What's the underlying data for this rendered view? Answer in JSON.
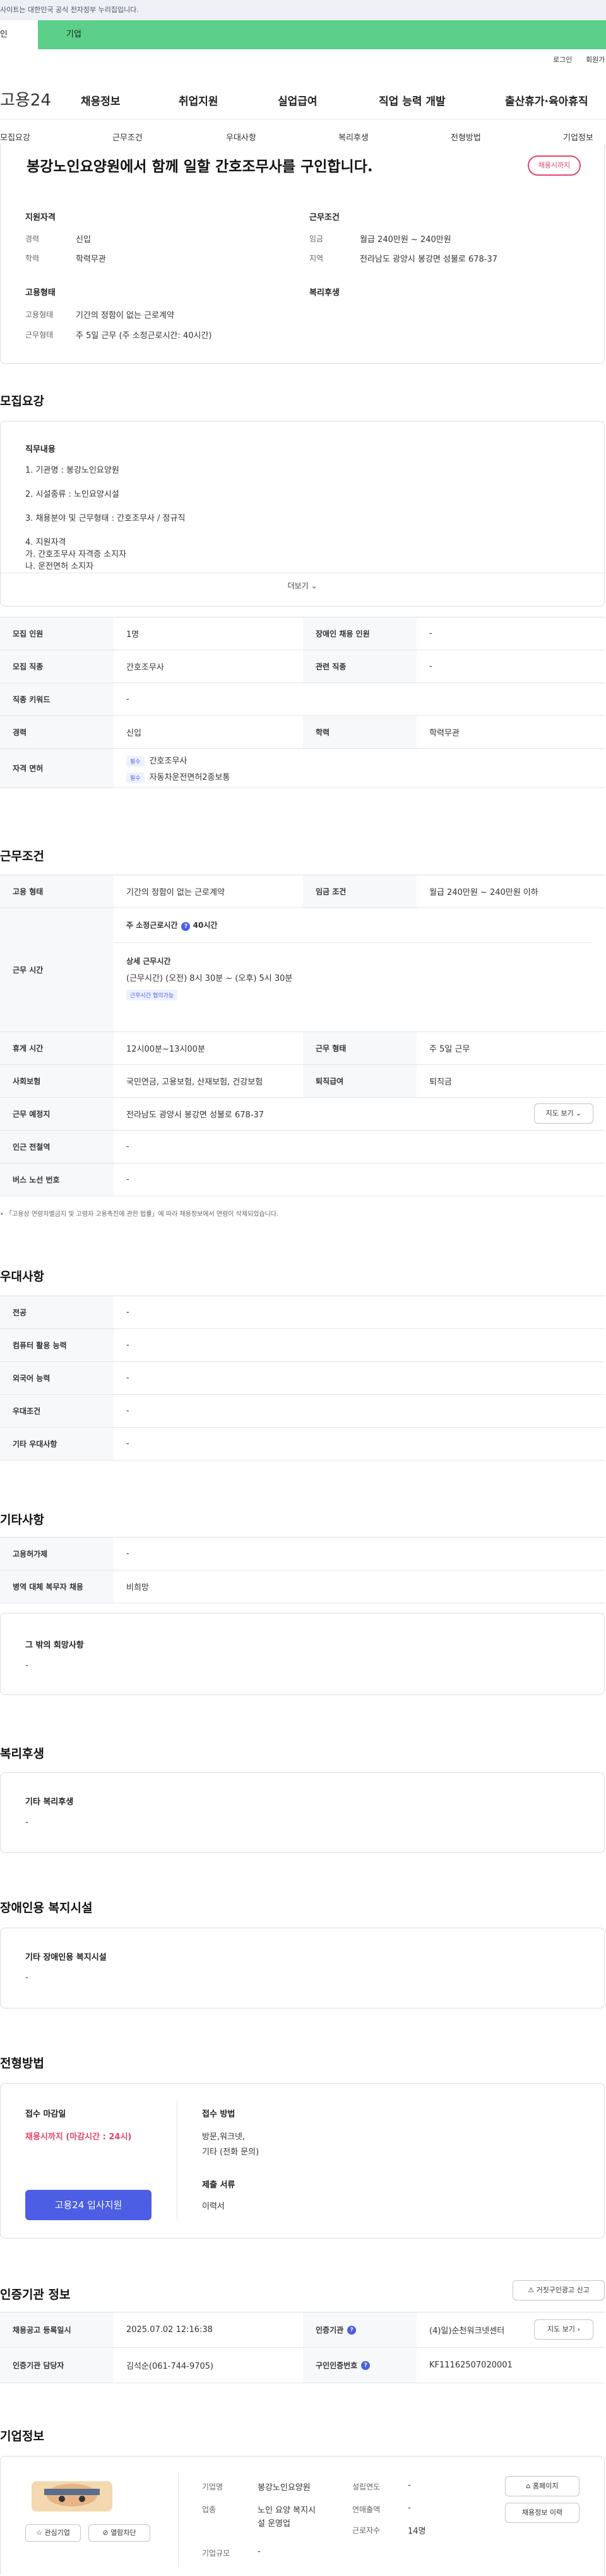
{
  "notice": "사이트는 대한민국 공식 전자정부 누리집입니다.",
  "tabs": [
    "인",
    "기업"
  ],
  "util": [
    "로그인",
    "회원가"
  ],
  "logo": "고용24",
  "gnb": [
    "채용정보",
    "취업지원",
    "실업급여",
    "직업 능력 개발",
    "출산휴가·육아휴직"
  ],
  "subnav": [
    "모집요강",
    "근무조건",
    "우대사항",
    "복리후생",
    "전형방법",
    "기업정보"
  ],
  "job": {
    "title": "봉강노인요양원에서 함께 일할 간호조무사를 구인합니다.",
    "deadline_badge": "채용시까지",
    "qual_h": "지원자격",
    "cond_h": "근무조건",
    "emp_h": "고용형태",
    "welfare_h": "복리후생",
    "career_l": "경력",
    "career_v": "신입",
    "edu_l": "학력",
    "edu_v": "학력무관",
    "wage_l": "임금",
    "wage_v": "월급 240만원 ~ 240만원",
    "area_l": "지역",
    "area_v": "전라남도 광양시 봉강면 성불로 678-37",
    "emptype_l": "고용형태",
    "emptype_v": "기간의 정함이 없는 근로계약",
    "worktype_l": "근무형태",
    "worktype_v": "주 5일 근무 (주 소정근로시간: 40시간)"
  },
  "recruit": {
    "section": "모집요강",
    "duty_h": "직무내용",
    "duty_lines": [
      "1. 기관명 : 봉강노인요양원",
      "2. 시설종류 : 노인요양시설",
      "3. 채용분야 및 근무형태 : 간호조무사 / 정규직",
      "4. 지원자격",
      "가. 간호조무사 자격증 소지자",
      "나. 운전면허 소지자"
    ],
    "more": "더보기",
    "rows": [
      [
        "모집 인원",
        "1명",
        "장애인 채용 인원",
        "-"
      ],
      [
        "모집 직종",
        "간호조무사",
        "관련 직종",
        "-"
      ],
      [
        "직종 키워드",
        "-"
      ],
      [
        "경력",
        "신입",
        "학력",
        "학력무관"
      ]
    ],
    "license_l": "자격 면허",
    "license_chip": "필수",
    "licenses": [
      "간호조무사",
      "자동차운전면허2종보통"
    ]
  },
  "work": {
    "section": "근무조건",
    "emptype_l": "고용 형태",
    "emptype_v": "기간의 정함이 없는 근로계약",
    "wage_l": "임금 조건",
    "wage_v": "월급 240만원 ~ 240만원 이하",
    "hours_l": "근무 시간",
    "hours_week": "주 소정근로시간",
    "hours_week_v": "40시간",
    "hours_detail_h": "상세 근무시간",
    "hours_detail_v": "(근무시간) (오전) 8시 30분 ~ (오후) 5시 30분",
    "hours_chip": "근무시간 협의가능",
    "rest_l": "휴게 시간",
    "rest_v": "12시00분~13시00분",
    "form_l": "근무 형태",
    "form_v": "주 5일 근무",
    "ins_l": "사회보험",
    "ins_v": "국민연금, 고용보험, 산재보험, 건강보험",
    "sev_l": "퇴직급여",
    "sev_v": "퇴직금",
    "place_l": "근무 예정지",
    "place_v": "전라남도 광양시 봉강면 성불로 678-37",
    "map_btn": "지도 보기",
    "subway_l": "인근 전철역",
    "subway_v": "-",
    "bus_l": "버스 노선 번호",
    "bus_v": "-",
    "note": "「고용상 연령차별금지 및 고령자 고용촉진에 관한 법률」에 따라 채용정보에서 연령이 삭제되었습니다."
  },
  "pref": {
    "section": "우대사항",
    "rows": [
      [
        "전공",
        "-"
      ],
      [
        "컴퓨터 활용 능력",
        "-"
      ],
      [
        "외국어 능력",
        "-"
      ],
      [
        "우대조건",
        "-"
      ],
      [
        "기타 우대사항",
        "-"
      ]
    ]
  },
  "etc": {
    "section": "기타사항",
    "rows": [
      [
        "고용허가제",
        "-"
      ],
      [
        "병역 대체 복무자 채용",
        "비희망"
      ]
    ],
    "other_h": "그 밖의 희망사항",
    "other_v": "-"
  },
  "welfare": {
    "section": "복리후생",
    "h": "기타 복리후생",
    "v": "-"
  },
  "disability": {
    "section": "장애인용 복지시설",
    "h": "기타 장애인용 복지시설",
    "v": "-"
  },
  "apply": {
    "section": "전형방법",
    "deadline_h": "접수 마감일",
    "deadline_v": "채용시까지 (마감시간 : 24시)",
    "method_h": "접수 방법",
    "method_v1": "방문,워크넷,",
    "method_v2": "기타 (전화 문의)",
    "docs_h": "제출 서류",
    "docs_v": "이력서",
    "btn": "고용24 입사지원"
  },
  "cert": {
    "section": "인증기관 정보",
    "report_btn": "거짓구인광고 신고",
    "reg_l": "채용공고 등록일시",
    "reg_v": "2025.07.02 12:16:38",
    "org_l": "인증기관",
    "org_v": "(4)일)순천워크넷센터",
    "mgr_l": "인증기관 담당자",
    "mgr_v": "김석순(061-744-9705)",
    "no_l": "구인인증번호",
    "no_v": "KF11162507020001",
    "map_btn": "지도 보기"
  },
  "company": {
    "section": "기업정보",
    "fav": "관심기업",
    "block": "열람차단",
    "name_l": "기업명",
    "name_v": "봉강노인요양원",
    "found_l": "설립연도",
    "found_v": "-",
    "ind_l": "업종",
    "ind_v1": "노인 요양 복지시",
    "ind_v2": "설 운영업",
    "sales_l": "연매출액",
    "sales_v": "-",
    "emp_l": "근로자수",
    "emp_v": "14명",
    "size_l": "기업규모",
    "size_v": "-",
    "home_btn": "홈페이지",
    "recruit_btn": "채용정보 이력"
  }
}
